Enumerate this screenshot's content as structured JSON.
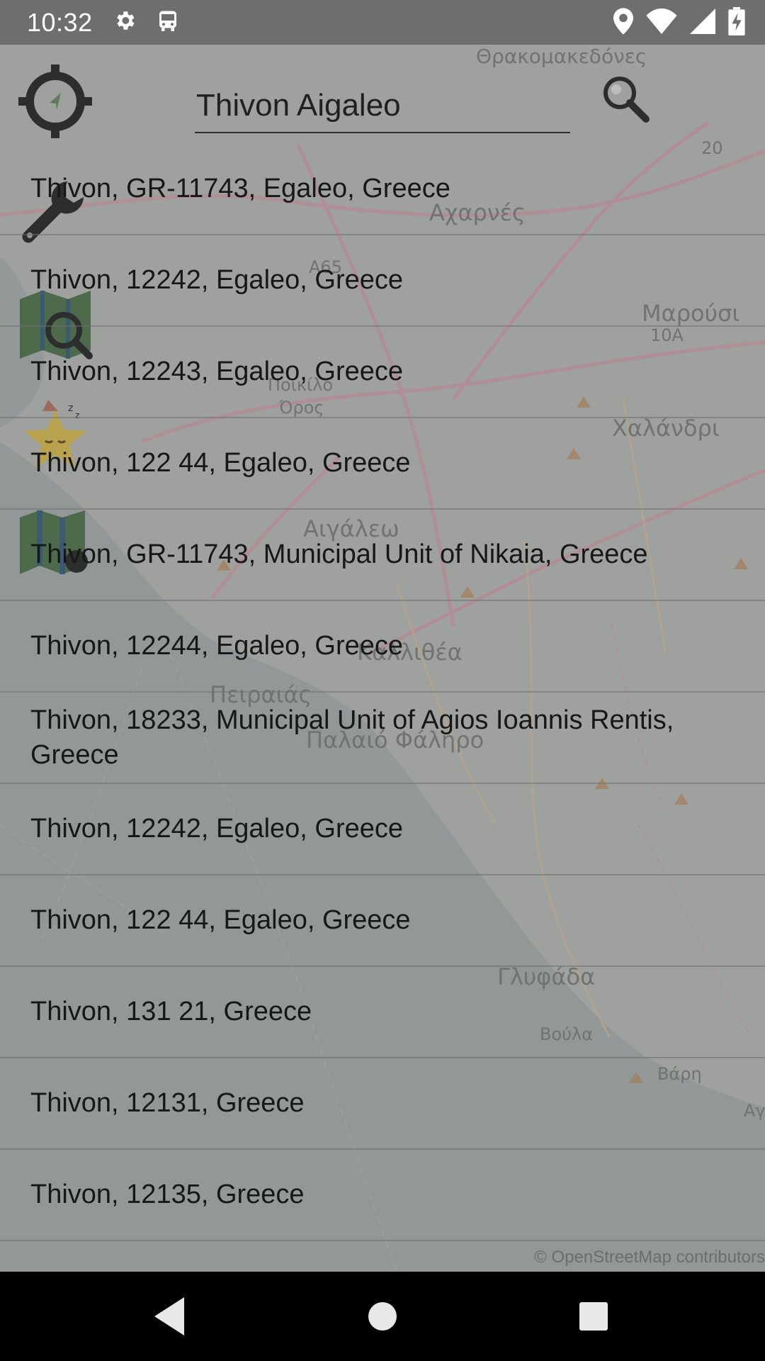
{
  "status_bar": {
    "time": "10:32",
    "icons": [
      "gear-icon",
      "bus-alarm-icon",
      "location-pin-icon",
      "wifi-icon",
      "signal-icon",
      "battery-charging-icon"
    ]
  },
  "search": {
    "value": "Thivon Aigaleo",
    "placeholder": ""
  },
  "results": [
    "Thivon, GR-11743, Egaleo, Greece",
    "Thivon, 12242, Egaleo, Greece",
    "Thivon, 12243, Egaleo, Greece",
    "Thivon, 122 44, Egaleo, Greece",
    "Thivon, GR-11743, Municipal Unit of Nikaia, Greece",
    "Thivon, 12244, Egaleo, Greece",
    "Thivon, 18233, Municipal Unit of Agios Ioannis Rentis, Greece",
    "Thivon, 12242, Egaleo, Greece",
    "Thivon, 122 44, Egaleo, Greece",
    "Thivon, 131 21, Greece",
    "Thivon, 12131, Greece",
    "Thivon, 12135, Greece"
  ],
  "map": {
    "labels": {
      "thrakomakedones": "Θρακομακεδόνες",
      "acharnes": "Αχαρνές",
      "marousi": "Μαρούσι",
      "chalandri": "Χαλάνδρι",
      "aigaleo": "Αιγάλεω",
      "kallithea": "Καλλιθέα",
      "peiraias": "Πειραιάς",
      "palaio_faliro": "Παλαιό Φάληρο",
      "glyfada": "Γλυφάδα",
      "voula": "Βούλα",
      "vari": "Βάρη",
      "poikilo_oros": "Ποικίλο",
      "oros": "Όρος",
      "a65": "A65",
      "ten_a": "10A",
      "road_20": "20",
      "edge_a": "Αγ"
    },
    "attribution": "© OpenStreetMap contributors"
  },
  "nav_bar": {
    "buttons": [
      "back-icon",
      "home-icon",
      "recents-icon"
    ]
  },
  "colors": {
    "status_bar": "#6e6e6e",
    "map_overlay": "#9ea19d",
    "nav_bar": "#000000",
    "text": "#161817"
  }
}
